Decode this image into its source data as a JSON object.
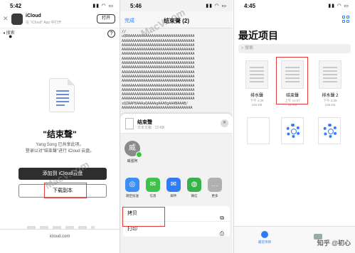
{
  "panel1": {
    "status_time": "5:42",
    "banner": {
      "close": "✕",
      "app_name": "iCloud",
      "app_sub": "在 \"iCloud\" App 中打开",
      "open_label": "打开"
    },
    "back_label": "◂ 搜索",
    "help": "?",
    "file_title": "\"结束聲\"",
    "desc_line1": "Yang Song 已共享此项。",
    "desc_line2": "登录以对\"结束聲\"进行 iCloud 云盘。",
    "add_label": "添加到 iCloud云盘",
    "download_label": "下载副本",
    "url": "icloud.com"
  },
  "panel2": {
    "status_time": "5:46",
    "done_label": "完成",
    "nav_title": "结束聲 (2)",
    "code_lines": [
      "//",
      "uQRAAAAAAAAAAAAAAAAAAAAAAAAAAAAAAA",
      "AAAAAAAAAAAAAAAAAAAAAAAAAAAAAAAAAA",
      "AAAAAAAAAAAAAAAAAAAAAAAAAAAAAAAAAA",
      "AAAAAAAAAAAAAAAAAAAAAAAAAAAAAAAAAA",
      "AAAAAAAAAAAAAAAAAAAAAAAAAAAAAAAAAA",
      "AAAAAAAAAAAAAAAAAAAAAAAAAAAAAAAAAA",
      "AAAAAAAAAAAAAAAAAAAAAAAAAAAAAAAAAA",
      "AAAAAAAAAAAAAAAAAAAAAAAAAAAAAAAAAA",
      "AAAAAAAAAAAAAAAAAAAAAAAAAAAAAAAAAA",
      "AAAAAAAAAAAAAAAAAAAAAAAAAAAAAAAAAA",
      "AAAAAAAAAAAAAAAAAAAAAAAAAAAAAAAAAA",
      "AAAAAAAAAAAAAAAAAAAAAAAAAAAAAAAAAA",
      "AAAAAAAAAAAAAAAAAAAAAAAAAAAAAAAAAA",
      "AAAAAAAAAAAAAAAAAAAAAAAAAAAAAAAAAA",
      "AAAAAAAAAAAAAAAAAAAAAAAAAAAAAAAAAA",
      "sQZAAP8AAAaQAAAAgAAA0gAAABAAAB/",
      "AAAAAAAAAAAAAAAAAAAAAAAAAAAAAAAAA"
    ],
    "sheet": {
      "file_name": "结束聲",
      "file_info": "文本文稿 · 12 KB",
      "close": "✕",
      "contact_initial": "威",
      "contact_label": "威强阿",
      "apps": [
        {
          "label": "隔空投送",
          "glyph": "◎",
          "color": "#3a8ef6"
        },
        {
          "label": "信息",
          "glyph": "✉",
          "color": "#3ec24a"
        },
        {
          "label": "邮件",
          "glyph": "✉",
          "color": "#2f7cf6"
        },
        {
          "label": "微信",
          "glyph": "◍",
          "color": "#35b24a"
        },
        {
          "label": "更多",
          "glyph": "…",
          "color": "#b0b0b0"
        }
      ],
      "copy_label": "拷贝",
      "copy_icon": "⧉",
      "print_label": "打印",
      "print_icon": "⎙"
    }
  },
  "panel3": {
    "status_time": "4:45",
    "title": "最近项目",
    "search_placeholder": "搜索",
    "files": [
      {
        "name": "排水聲",
        "date": "下午 4:28",
        "size": "150 KB"
      },
      {
        "name": "结束聲",
        "date": "上午 11:57",
        "size": "12 KB"
      },
      {
        "name": "排水聲 2",
        "date": "下午 4:28",
        "size": "138 KB"
      }
    ],
    "tab_recent": "最近项目"
  },
  "watermark": "MacV.com",
  "credit": "知乎 @初心",
  "colors": {
    "highlight": "#e23b3b",
    "accent": "#2f7cf6"
  }
}
